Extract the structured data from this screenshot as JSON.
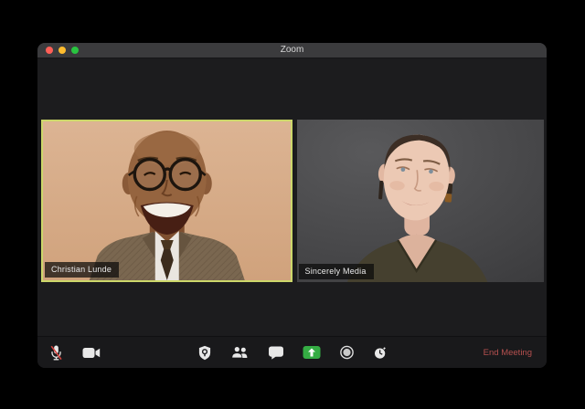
{
  "window": {
    "title": "Zoom",
    "traffic_lights": [
      "close",
      "minimize",
      "fullscreen"
    ]
  },
  "participants": [
    {
      "name": "Christian Lunde",
      "active_speaker": true
    },
    {
      "name": "Sincerely Media",
      "active_speaker": false
    }
  ],
  "toolbar": {
    "left_icons": [
      "microphone-muted-icon",
      "video-camera-icon"
    ],
    "center_icons": [
      "security-shield-icon",
      "participants-icon",
      "chat-icon",
      "share-screen-icon",
      "record-icon",
      "clock-icon"
    ],
    "end_meeting_label": "End Meeting"
  },
  "colors": {
    "active_speaker_border": "#ccd76a",
    "share_screen_green": "#35ad44",
    "end_meeting_red": "#b5504f",
    "mute_slash_red": "#d64541",
    "traffic_red": "#ff5f57",
    "traffic_yellow": "#febc2e",
    "traffic_green": "#29c440",
    "titlebar_gray": "#3b3b3d",
    "window_background": "#1c1c1e"
  }
}
